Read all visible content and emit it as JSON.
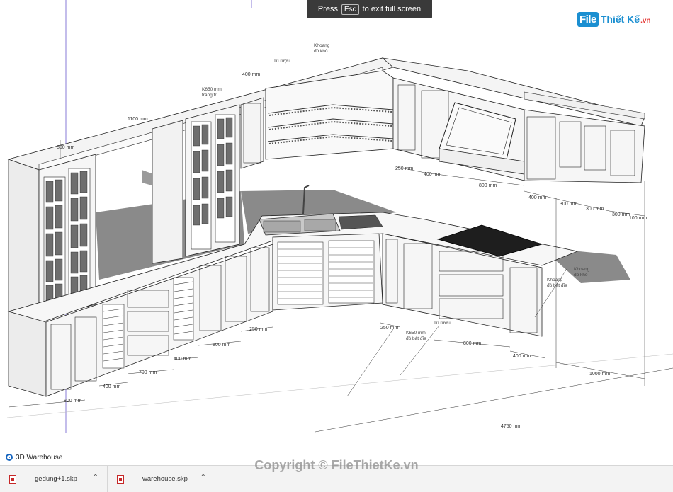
{
  "fullscreen_notice": {
    "press": "Press",
    "key": "Esc",
    "suffix": "to exit full screen"
  },
  "watermark_logo": {
    "box": "File",
    "rest": "Thiết Kế",
    "tld": ".vn"
  },
  "copyright": "Copyright © FileThietKe.vn",
  "warehouse": {
    "label": "3D Warehouse"
  },
  "downloads": [
    {
      "name": "gedung+1.skp"
    },
    {
      "name": "warehouse.skp"
    }
  ],
  "colors": {
    "accent": "#1b8fd1",
    "banner": "#3a3a3a",
    "shadow": "#8a8a8a",
    "tld": "#e53935"
  },
  "icons": {
    "file": "skp-file-icon",
    "chevron": "chevron-up-icon",
    "warehouse": "warehouse-logo-icon"
  },
  "dimensions": {
    "d800_top": "800 mm",
    "d400_top": "400 mm",
    "d1100": "1100 mm",
    "d250_up": "250 mm",
    "d400_up": "400 mm",
    "d800_up": "800 mm",
    "d400_up2": "400 mm",
    "d300_a": "300 mm",
    "d300_b": "300 mm",
    "d300_c": "300 mm",
    "d100": "100 mm",
    "d250_low": "250 mm",
    "d400_low": "400 mm",
    "d800_low": "800 mm",
    "d700_low": "700 mm",
    "d400_low2": "400 mm",
    "d800_low2": "800 mm",
    "d250_mid": "250 mm",
    "d250_right": "250 mm",
    "d800_right": "800 mm",
    "d400_right": "400 mm",
    "d1000": "1000 mm",
    "d4750": "4750 mm"
  },
  "notes": {
    "khoang_kho_1": "Khoang",
    "khoang_kho_2": "đồ khô",
    "tu_ruou_top": "Tủ rượu",
    "k650_tl_1": "K650 mm",
    "k650_tl_2": "trang trí",
    "tu_ruou_mid": "Tủ rượu",
    "k650_bat_1": "K650 mm",
    "k650_bat_2": "đồ bát đĩa",
    "khoang_bat_1": "Khoang",
    "khoang_bat_2": "đồ bát đĩa",
    "khoang_kho_r1": "Khoang",
    "khoang_kho_r2": "đồ khô"
  }
}
